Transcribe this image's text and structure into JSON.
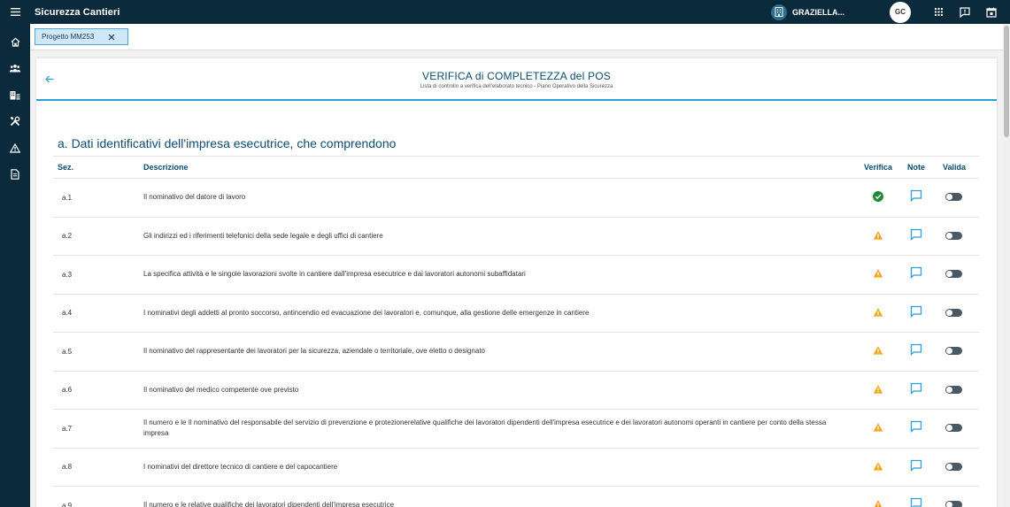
{
  "app": {
    "title": "Sicurezza Cantieri"
  },
  "user": {
    "name": "GRAZIELLA...",
    "initials": "GC"
  },
  "tab": {
    "label": "Progetto MM253"
  },
  "header": {
    "title": "VERIFICA di COMPLETEZZA del POS",
    "subtitle": "Lista di controllo a verifica dell'elaborato tecnico - Piano Operativo della Sicurezza"
  },
  "section": {
    "title": "a. Dati identificativi dell'impresa esecutrice, che comprendono"
  },
  "table": {
    "headers": {
      "sez": "Sez.",
      "descrizione": "Descrizione",
      "verifica": "Verifica",
      "note": "Note",
      "valida": "Valida"
    },
    "rows": [
      {
        "sez": "a.1",
        "desc": "Il nominativo del datore di lavoro",
        "status": "ok"
      },
      {
        "sez": "a.2",
        "desc": "Gli indirizzi ed i riferimenti telefonici della sede legale e degli uffici di cantiere",
        "status": "warn"
      },
      {
        "sez": "a.3",
        "desc": "La specifica attività e le singole lavorazioni svolte in cantiere dall'impresa esecutrice e dai lavoratori autonomi subaffidatari",
        "status": "warn"
      },
      {
        "sez": "a.4",
        "desc": "I nominativi degli addetti al pronto soccorso, antincendio ed evacuazione dei lavoratori e, comunque, alla gestione delle emergenze in cantiere",
        "status": "warn"
      },
      {
        "sez": "a.5",
        "desc": "Il nominativo del rappresentante dei lavoratori per la sicurezza, aziendale o territoriale, ove eletto o designato",
        "status": "warn"
      },
      {
        "sez": "a.6",
        "desc": "Il nominativo del medico competente ove previsto",
        "status": "warn"
      },
      {
        "sez": "a.7",
        "desc": "Il numero e le Il nominativo del responsabile del servizio di prevenzione e protezionerelative qualifiche dei lavoratori dipendenti dell'impresa esecutrice e dei lavoratori autonomi operanti in cantiere per conto della stessa impresa",
        "status": "warn"
      },
      {
        "sez": "a.8",
        "desc": "I nominativi del direttore tecnico di cantiere e del capocantiere",
        "status": "warn"
      },
      {
        "sez": "a.9",
        "desc": "Il numero e le relative qualifiche dei lavoratori dipendenti dell'impresa esecutrice",
        "status": "warn"
      }
    ]
  },
  "colors": {
    "ok": "#1e8b3a",
    "warn": "#f2a516",
    "accent": "#2a9fd8",
    "dark": "#0b2a3b"
  },
  "icons": {
    "topbar": [
      "menu-icon",
      "building-icon",
      "apps-grid-icon",
      "feedback-icon",
      "calendar-icon"
    ],
    "sidebar": [
      "home-icon",
      "users-icon",
      "building-list-icon",
      "tools-icon",
      "warning-icon",
      "document-icon"
    ]
  }
}
